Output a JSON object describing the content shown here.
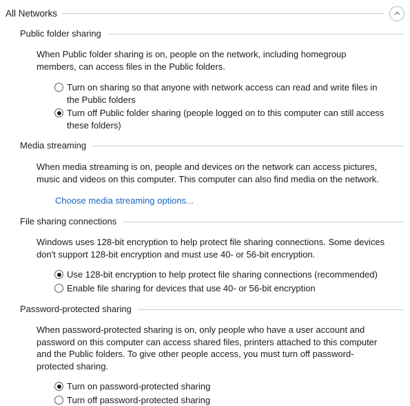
{
  "group": {
    "title": "All Networks",
    "collapse_icon": "chevron-up-icon"
  },
  "colors": {
    "link": "#1767c2",
    "text": "#1b1b1b",
    "rule": "#cfcfcf",
    "background": "#ffffff"
  },
  "sections": [
    {
      "id": "public-folder-sharing",
      "title": "Public folder sharing",
      "description": "When Public folder sharing is on, people on the network, including homegroup members, can access files in the Public folders.",
      "options": [
        {
          "label": "Turn on sharing so that anyone with network access can read and write files in the Public folders",
          "selected": false
        },
        {
          "label": "Turn off Public folder sharing (people logged on to this computer can still access these folders)",
          "selected": true
        }
      ]
    },
    {
      "id": "media-streaming",
      "title": "Media streaming",
      "description": "When media streaming is on, people and devices on the network can access pictures, music and videos on this computer. This computer can also find media on the network.",
      "link": "Choose media streaming options..."
    },
    {
      "id": "file-sharing-connections",
      "title": "File sharing connections",
      "description": "Windows uses 128-bit encryption to help protect file sharing connections. Some devices don't support 128-bit encryption and must use 40- or 56-bit encryption.",
      "options": [
        {
          "label": "Use 128-bit encryption to help protect file sharing connections (recommended)",
          "selected": true
        },
        {
          "label": "Enable file sharing for devices that use 40- or 56-bit encryption",
          "selected": false
        }
      ]
    },
    {
      "id": "password-protected-sharing",
      "title": "Password-protected sharing",
      "description": "When password-protected sharing is on, only people who have a user account and password on this computer can access shared files, printers attached to this computer and the Public folders. To give other people access, you must turn off password-protected sharing.",
      "options": [
        {
          "label": "Turn on password-protected sharing",
          "selected": true
        },
        {
          "label": "Turn off password-protected sharing",
          "selected": false
        }
      ]
    }
  ]
}
